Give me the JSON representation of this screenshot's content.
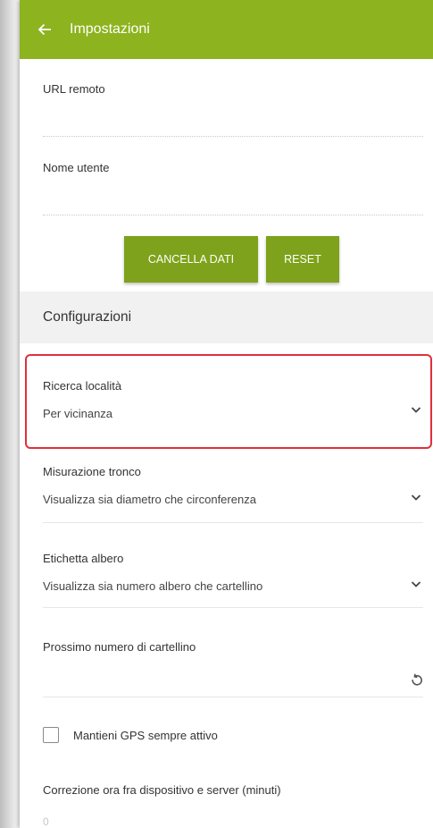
{
  "appbar": {
    "title": "Impostazioni",
    "back_icon": "arrow-left-icon"
  },
  "fields": {
    "remote_url_label": "URL remoto",
    "username_label": "Nome utente"
  },
  "buttons": {
    "clear_data": "CANCELLA DATI",
    "reset": "RESET"
  },
  "section": {
    "title": "Configurazioni"
  },
  "settings": {
    "location_search": {
      "label": "Ricerca località",
      "value": "Per vicinanza"
    },
    "trunk_measure": {
      "label": "Misurazione tronco",
      "value": "Visualizza sia diametro che circonferenza"
    },
    "tree_label": {
      "label": "Etichetta albero",
      "value": "Visualizza sia numero albero che cartellino"
    },
    "next_tag": {
      "label": "Prossimo numero di cartellino"
    },
    "gps_always": {
      "label": "Mantieni GPS sempre attivo",
      "checked": false
    },
    "time_correction": {
      "label": "Correzione ora fra dispositivo e server (minuti)",
      "value": "0"
    }
  },
  "colors": {
    "primary": "#8db31e",
    "button": "#7ea21b",
    "highlight": "#e0303c",
    "section_bg": "#f1f1f1"
  }
}
